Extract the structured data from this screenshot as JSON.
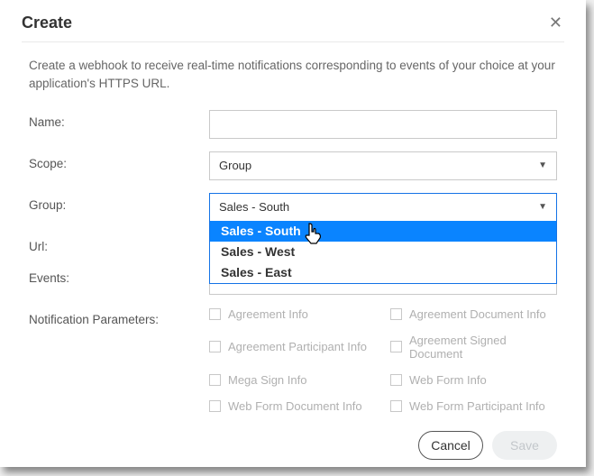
{
  "dialog": {
    "title": "Create",
    "description": "Create a webhook to receive real-time notifications corresponding to events of your choice at your application's HTTPS URL."
  },
  "labels": {
    "name": "Name:",
    "scope": "Scope:",
    "group": "Group:",
    "url": "Url:",
    "events": "Events:",
    "notif": "Notification Parameters:"
  },
  "fields": {
    "name_value": "",
    "scope_value": "Group",
    "group_value": "Sales - South",
    "url_value": "",
    "events_value": ""
  },
  "group_options": [
    "Sales - South",
    "Sales - West",
    "Sales - East"
  ],
  "notif_params": {
    "c1": "Agreement Info",
    "c2": "Agreement Document Info",
    "c3": "Agreement Participant Info",
    "c4": "Agreement Signed Document",
    "c5": "Mega Sign Info",
    "c6": "Web Form Info",
    "c7": "Web Form Document Info",
    "c8": "Web Form Participant Info"
  },
  "buttons": {
    "cancel": "Cancel",
    "save": "Save"
  }
}
